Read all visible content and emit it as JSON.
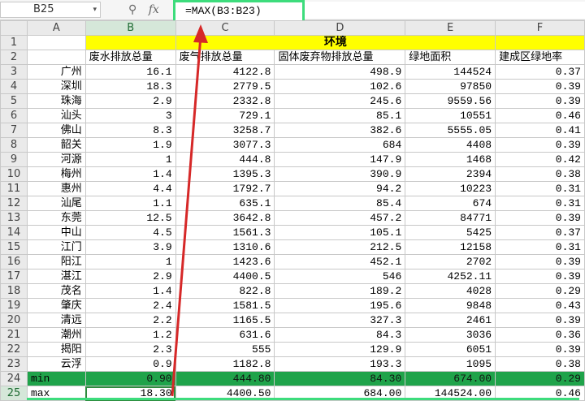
{
  "name_box": {
    "value": "B25",
    "dropdown": "▾"
  },
  "formula_bar": {
    "icons": [
      "zoom-icon",
      "fx-icon"
    ],
    "zoom_glyph": "⚲",
    "fx_label": "fx",
    "formula": "=MAX(B3:B23)"
  },
  "columns": [
    "A",
    "B",
    "C",
    "D",
    "E",
    "F"
  ],
  "selected_column": "B",
  "title_row": {
    "row": "1",
    "text": "环境"
  },
  "header_row": {
    "row": "2",
    "labels": [
      "",
      "废水排放总量",
      "废气排放总量",
      "固体废弃物排放总量",
      "绿地面积",
      "建成区绿地率"
    ]
  },
  "rows": [
    {
      "row": "3",
      "city": "广州",
      "b": "16.1",
      "c": "4122.8",
      "d": "498.9",
      "e": "144524",
      "f": "0.37"
    },
    {
      "row": "4",
      "city": "深圳",
      "b": "18.3",
      "c": "2779.5",
      "d": "102.6",
      "e": "97850",
      "f": "0.39"
    },
    {
      "row": "5",
      "city": "珠海",
      "b": "2.9",
      "c": "2332.8",
      "d": "245.6",
      "e": "9559.56",
      "f": "0.39"
    },
    {
      "row": "6",
      "city": "汕头",
      "b": "3",
      "c": "729.1",
      "d": "85.1",
      "e": "10551",
      "f": "0.46"
    },
    {
      "row": "7",
      "city": "佛山",
      "b": "8.3",
      "c": "3258.7",
      "d": "382.6",
      "e": "5555.05",
      "f": "0.41"
    },
    {
      "row": "8",
      "city": "韶关",
      "b": "1.9",
      "c": "3077.3",
      "d": "684",
      "e": "4408",
      "f": "0.39"
    },
    {
      "row": "9",
      "city": "河源",
      "b": "1",
      "c": "444.8",
      "d": "147.9",
      "e": "1468",
      "f": "0.42"
    },
    {
      "row": "10",
      "city": "梅州",
      "b": "1.4",
      "c": "1395.3",
      "d": "390.9",
      "e": "2394",
      "f": "0.38"
    },
    {
      "row": "11",
      "city": "惠州",
      "b": "4.4",
      "c": "1792.7",
      "d": "94.2",
      "e": "10223",
      "f": "0.31"
    },
    {
      "row": "12",
      "city": "汕尾",
      "b": "1.1",
      "c": "635.1",
      "d": "85.4",
      "e": "674",
      "f": "0.31"
    },
    {
      "row": "13",
      "city": "东莞",
      "b": "12.5",
      "c": "3642.8",
      "d": "457.2",
      "e": "84771",
      "f": "0.39"
    },
    {
      "row": "14",
      "city": "中山",
      "b": "4.5",
      "c": "1561.3",
      "d": "105.1",
      "e": "5425",
      "f": "0.37"
    },
    {
      "row": "15",
      "city": "江门",
      "b": "3.9",
      "c": "1310.6",
      "d": "212.5",
      "e": "12158",
      "f": "0.31"
    },
    {
      "row": "16",
      "city": "阳江",
      "b": "1",
      "c": "1423.6",
      "d": "452.1",
      "e": "2702",
      "f": "0.39"
    },
    {
      "row": "17",
      "city": "湛江",
      "b": "2.9",
      "c": "4400.5",
      "d": "546",
      "e": "4252.11",
      "f": "0.39"
    },
    {
      "row": "18",
      "city": "茂名",
      "b": "1.4",
      "c": "822.8",
      "d": "189.2",
      "e": "4028",
      "f": "0.29"
    },
    {
      "row": "19",
      "city": "肇庆",
      "b": "2.4",
      "c": "1581.5",
      "d": "195.6",
      "e": "9848",
      "f": "0.43"
    },
    {
      "row": "20",
      "city": "清远",
      "b": "2.2",
      "c": "1165.5",
      "d": "327.3",
      "e": "2461",
      "f": "0.39"
    },
    {
      "row": "21",
      "city": "潮州",
      "b": "1.2",
      "c": "631.6",
      "d": "84.3",
      "e": "3036",
      "f": "0.36"
    },
    {
      "row": "22",
      "city": "揭阳",
      "b": "2.3",
      "c": "555",
      "d": "129.9",
      "e": "6051",
      "f": "0.39"
    },
    {
      "row": "23",
      "city": "云浮",
      "b": "0.9",
      "c": "1182.8",
      "d": "193.3",
      "e": "1095",
      "f": "0.38"
    }
  ],
  "min_row": {
    "row": "24",
    "label": "min",
    "b": "0.90",
    "c": "444.80",
    "d": "84.30",
    "e": "674.00",
    "f": "0.29"
  },
  "max_row": {
    "row": "25",
    "label": "max",
    "b": "18.30",
    "c": "4400.50",
    "d": "684.00",
    "e": "144524.00",
    "f": "0.46"
  },
  "colors": {
    "title_fill": "#ffff00",
    "min_row_fill": "#1fa34a",
    "annotation_arrow": "#d62828",
    "highlight_box": "#3ddc7c"
  }
}
